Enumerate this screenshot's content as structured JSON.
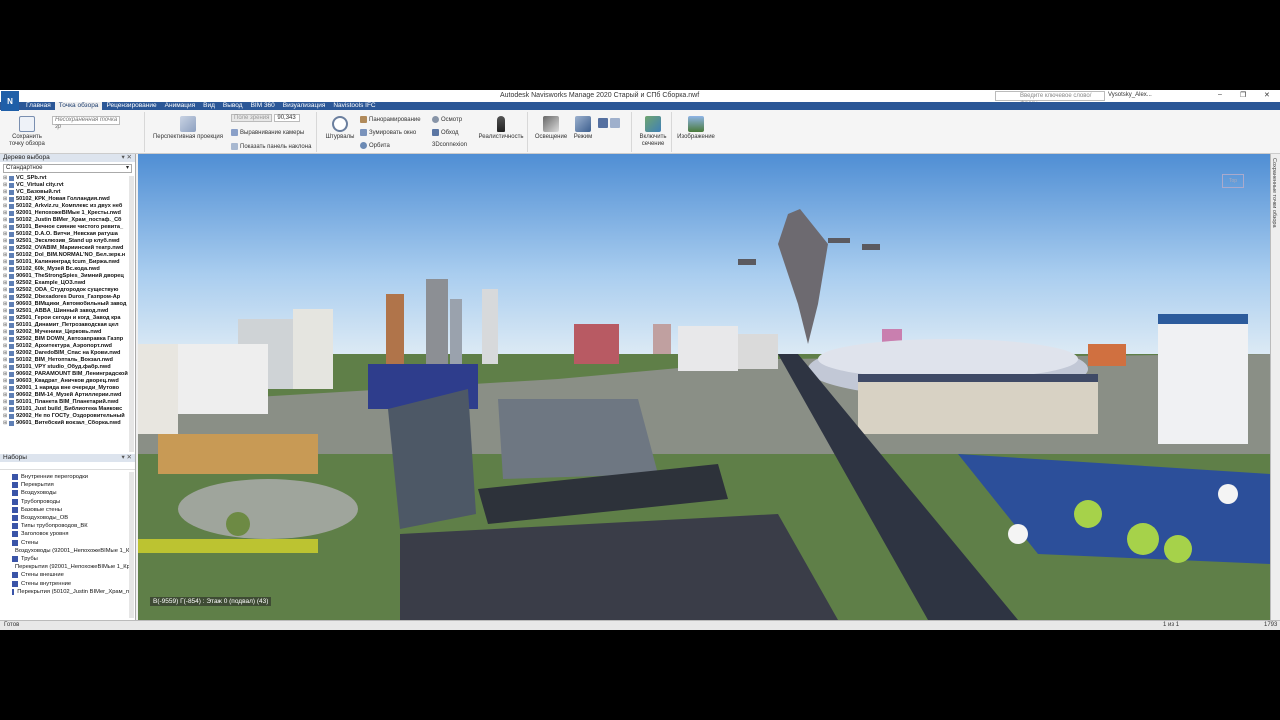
{
  "window": {
    "title": "Autodesk Navisworks Manage 2020   Старый и СПб Сборка.nwf",
    "app_icon": "N",
    "search_placeholder": "Введите ключевое слово/фразу",
    "user": "Vysotsky_Alex...",
    "controls": [
      "–",
      "❐",
      "✕"
    ]
  },
  "tabs": [
    "Главная",
    "Точка обзора",
    "Рецензирование",
    "Анимация",
    "Вид",
    "Вывод",
    "BIM 360",
    "Визуализация",
    "Navistools IFC"
  ],
  "active_tab": "Точка обзора",
  "ribbon": {
    "save_viewpoint": "Сохранить точку обзора",
    "viewpoint_field": "Несохраненная точка зр",
    "perspective": "Перспективная проекция",
    "camera_field_label": "Поле зрения",
    "camera_field_value": "90,343",
    "align_camera": "Выравнивание камеры",
    "show_tilt": "Показать панель наклона",
    "steering": "Штурвалы",
    "pan": "Панорамирование",
    "zoom_window": "Зумировать окно",
    "orbit": "Орбита",
    "look_around": "Осмотр",
    "walk": "Обход",
    "connexion": "3Dconnexion",
    "realism": "Реалистичность",
    "lighting": "Освещение",
    "mode": "Режим",
    "sectioning": "Включить сечение",
    "image": "Изображение"
  },
  "selection_tree": {
    "title": "Дерево выбора",
    "dropdown": "Стандартное",
    "items": [
      "VC_SPb.rvt",
      "VC_Virtual city.rvt",
      "VC_Базовый.rvt",
      "50102_КРК_Новая Голландия.nwd",
      "50102_Arkviz.ru_Комплекс из двух неб",
      "92001_НепохожеBIMые 1_Кресты.nwd",
      "50102_Justin BIMer_Храм_постаф._Сб",
      "50101_Вечное сияние чистого ревита_",
      "50102_D.A.O. Витчи_Невская ратуша",
      "92501_Эксклюзив_Stand up клуб.nwd",
      "92502_OVABIM_Мариинский театр.nwd",
      "50102_Dol_BIM.NORMAL'NO_Бел.зерк.н",
      "50101_Калининград tcum_Биржа.nwd",
      "50102_60k_Музей Вс.кода.nwd",
      "90601_TheStrongSpies_Зимний дворец",
      "92502_Example_ЦОЗ.nwd",
      "92502_ODA_Студгородок существую",
      "92502_Dbexadores Duros_Газпром-Ар",
      "90603_BIMщики_Автомобильный завод",
      "92501_ABBA_Шинный завод.nwd",
      "92501_Герои сегодн и когд_Завод кра",
      "50101_Динамит_Петрозаводская цел",
      "92002_Мученики_Церковь.nwd",
      "92502_BIM DOWN_Автозаправка Газпр",
      "50102_Архитектура_Аэропорт.nwd",
      "92002_DaredoBIM_Спас на Крови.nwd",
      "50102_BIM_Нетопталь_Вокзал.nwd",
      "50101_VPY studio_Обуд.фабр.nwd",
      "90602_PARAMOUNT BIM_Ленинградской",
      "90603_Квадрат_Аничков дворец.nwd",
      "92001_1 наряда вне очереди_Мутово",
      "90602_BIM-14_Музей Артиллерии.nwd",
      "50101_Планета BIM_Планетарий.nwd",
      "50101_Just build_Библиотека Маяковс",
      "92002_Не по ГОСТу_Оздоровительный",
      "90601_Витебский вокзал_Сборка.nwd"
    ]
  },
  "sets": {
    "title": "Наборы",
    "items": [
      "Внутренние перегородки",
      "Перекрытия",
      "Воздуховоды",
      "Трубопроводы",
      "Базовые стены",
      "Воздуховоды_ОВ",
      "Типы трубопроводов_ВК",
      "Заголовок уровня",
      "Стены",
      "Воздуховоды (92001_НепохожеBIMые 1_Кр",
      "Трубы",
      "Перекрытия (92001_НепохожеBIMые 1_Кр",
      "Стены внешние",
      "Стены внутренние",
      "Перекрытия (50102_Justin BIMer_Храм_п"
    ]
  },
  "viewport": {
    "coords": "В(-9559) Г(-854) : Этаж 0 (подвал) (43)",
    "navcube": "Top"
  },
  "right_strip": "Сохраненные точки обзора",
  "status": {
    "left": "Готов",
    "page": "1 из 1",
    "memory": "1793"
  }
}
